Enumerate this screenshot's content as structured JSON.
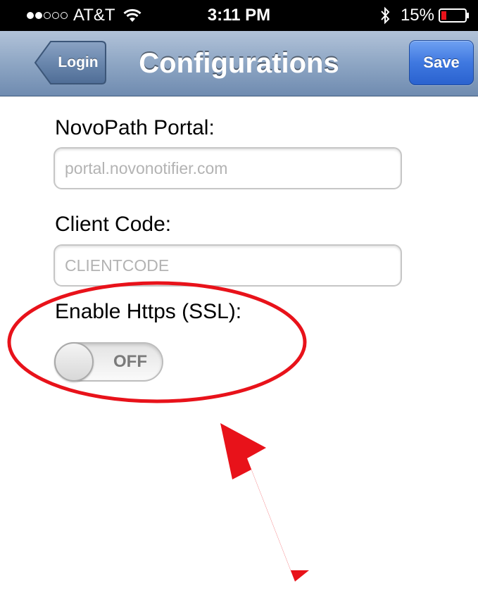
{
  "status_bar": {
    "signal_bars_filled": 2,
    "signal_bars_total": 5,
    "carrier": "AT&T",
    "time": "3:11 PM",
    "battery_percent": "15%",
    "icons": [
      "wifi-icon",
      "bluetooth-icon",
      "battery-icon"
    ]
  },
  "nav_bar": {
    "back_label": "Login",
    "title": "Configurations",
    "save_label": "Save"
  },
  "form": {
    "portal": {
      "label": "NovoPath Portal:",
      "value": "",
      "placeholder": "portal.novonotifier.com"
    },
    "client_code": {
      "label": "Client Code:",
      "value": "",
      "placeholder": "CLIENTCODE"
    },
    "https": {
      "label": "Enable Https (SSL):",
      "toggle_label": "OFF",
      "enabled": false
    }
  },
  "annotation": {
    "color": "#e8121a"
  }
}
